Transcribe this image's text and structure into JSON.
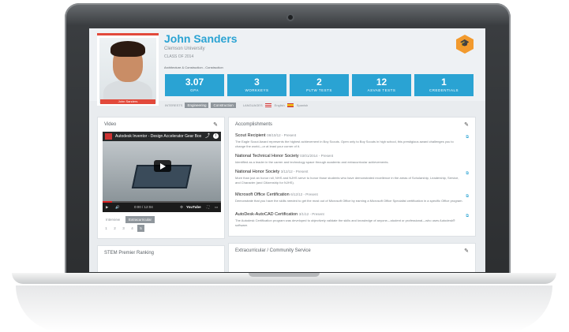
{
  "profile": {
    "name": "John Sanders",
    "school": "Clemson University",
    "class": "CLASS OF 2014",
    "pathway": "Architecture & Construction - Construction",
    "photo_caption": "John Sanders"
  },
  "stats": [
    {
      "value": "3.07",
      "label": "GPA"
    },
    {
      "value": "3",
      "label": "WORKKEYS"
    },
    {
      "value": "2",
      "label": "PLTW TESTS"
    },
    {
      "value": "12",
      "label": "ASVAB TESTS"
    },
    {
      "value": "1",
      "label": "CREDENTIALS"
    }
  ],
  "tags": {
    "interests_label": "INTERESTS",
    "interests": [
      "Engineering",
      "Construction"
    ],
    "languages_label": "LANGUAGES",
    "languages": [
      "English",
      "Spanish"
    ]
  },
  "video_panel": {
    "title": "Video",
    "video_title": "Autodesk Inventor - Design Accelerator Gear Box",
    "time": "0:00 / 12:04",
    "progress": 0.08,
    "tabs": [
      "Interview",
      "Extracurricular"
    ],
    "active_tab": "Extracurricular",
    "pages": [
      "1",
      "2",
      "3",
      "4",
      "5"
    ],
    "active_page": "5"
  },
  "accomplishments": {
    "title": "Accomplishments",
    "items": [
      {
        "title": "Scout Recipient",
        "date": "08/10/12 - Present",
        "desc": "The Eagle Scout Award represents the highest achievement in Boy Scouts. Open only to Boy Scouts in high school, this prestigious award challenges you to change the world—or at least your corner of it."
      },
      {
        "title": "National Technical Honor Society",
        "date": "03/01/2014 - Present",
        "desc": "Identified as a leader in the career and technology space through academic and extracurricular achievements."
      },
      {
        "title": "National Honor Society",
        "date": "3/12/12 - Present",
        "desc": "More than just an honor roll, NHS and NJHS serve to honor those students who have demonstrated excellence in the areas of Scholarship, Leadership, Service, and Character (and Citizenship for NJHS)."
      },
      {
        "title": "Microsoft Office Certification",
        "date": "6/12/12 - Present",
        "desc": "Demonstrate that you have the skills needed to get the most out of Microsoft Office by earning a Microsoft Office Specialist certification in a specific Office program."
      },
      {
        "title": "AutoDesk-AutoCAD Certification",
        "date": "3/1/12 - Present",
        "desc": "The Autodesk Certification program was developed to objectively validate the skills and knowledge of anyone—student or professional—who uses Autodesk® software."
      }
    ]
  },
  "extracurricular": {
    "title": "Extracurricular / Community Service"
  },
  "stem": {
    "title": "STEM Premier Ranking"
  },
  "icons": {
    "edit": "pencil-icon",
    "external": "external-link-icon",
    "logo": "graduation-cap-icon"
  },
  "colors": {
    "accent": "#2aa3d3",
    "photo_band": "#e2493b",
    "logo": "#f29a2e"
  }
}
